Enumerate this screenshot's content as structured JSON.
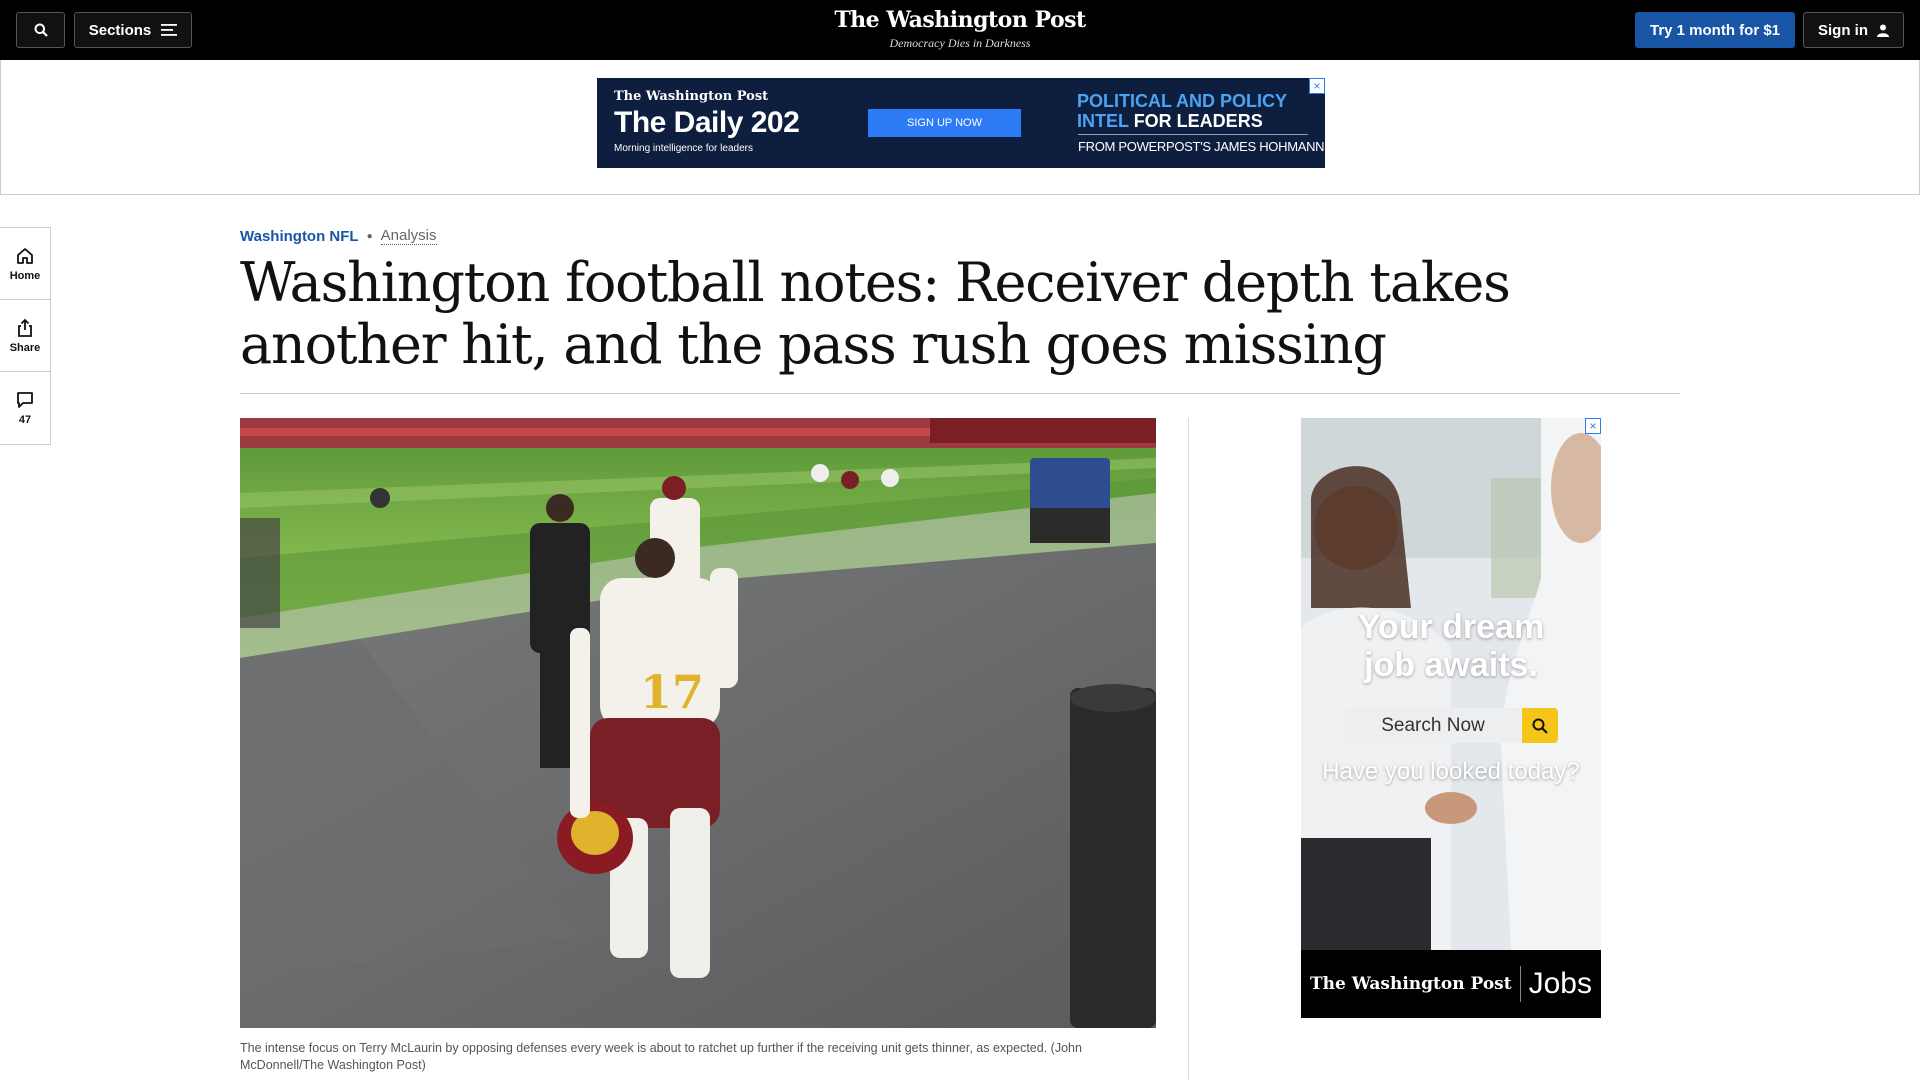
{
  "topbar": {
    "sections_label": "Sections",
    "logo": "The Washington Post",
    "tagline": "Democracy Dies in Darkness",
    "trial_label": "Try 1 month for $1",
    "signin_label": "Sign in"
  },
  "top_ad": {
    "logo": "The Washington Post",
    "title": "The Daily 202",
    "subtitle": "Morning intelligence for leaders",
    "cta": "SIGN UP NOW",
    "headline_blue": "POLITICAL AND POLICY INTEL",
    "headline_white": "FOR LEADERS",
    "from": "FROM POWERPOST'S JAMES HOHMANN",
    "close": "×"
  },
  "rail": {
    "home": "Home",
    "share": "Share",
    "comments": "47"
  },
  "article": {
    "section": "Washington NFL",
    "label": "Analysis",
    "headline": "Washington football notes: Receiver depth takes another hit, and the pass rush goes missing",
    "caption": "The intense focus on Terry McLaurin by opposing defenses every week is about to ratchet up further if the receiving unit gets thinner, as expected. (John McDonnell/The Washington Post)"
  },
  "side_ad": {
    "headline_1": "Your dream",
    "headline_2": "job awaits.",
    "search_label": "Search Now",
    "question": "Have you looked today?",
    "footer_logo": "The Washington Post",
    "footer_brand": "Jobs",
    "close": "×"
  },
  "colors": {
    "accent": "#1955a5",
    "topbar": "#000000",
    "ad_navy": "#0d1e3f",
    "ad_blue": "#2d7cf6",
    "jobs_yellow": "#f5c518"
  }
}
